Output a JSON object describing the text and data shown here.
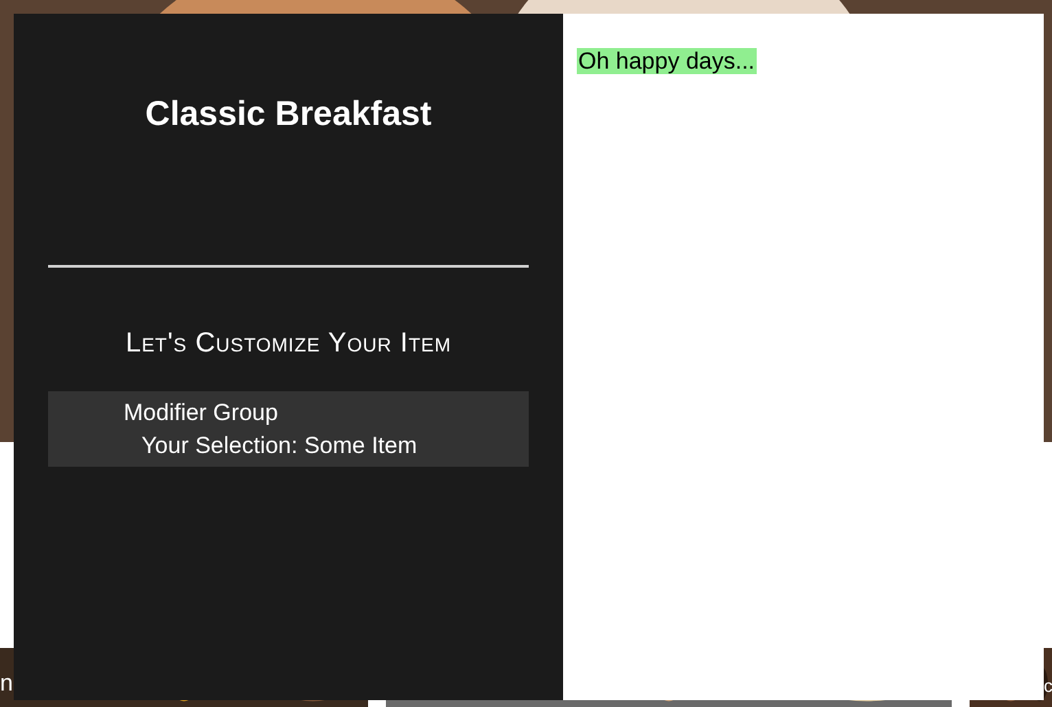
{
  "background": {
    "tiles": [
      {
        "kind": "picture"
      },
      {
        "kind": "picture",
        "caption": "n"
      },
      {
        "kind": "picture"
      },
      {
        "kind": "picture",
        "caption": "c"
      }
    ]
  },
  "dialog": {
    "title": "Classic Breakfast",
    "heading": "Let's Customize Your Item",
    "modifier_groups": [
      {
        "name": "Modifier Group",
        "selection": "Your Selection: Some Item"
      }
    ],
    "message": "Oh happy days..."
  }
}
